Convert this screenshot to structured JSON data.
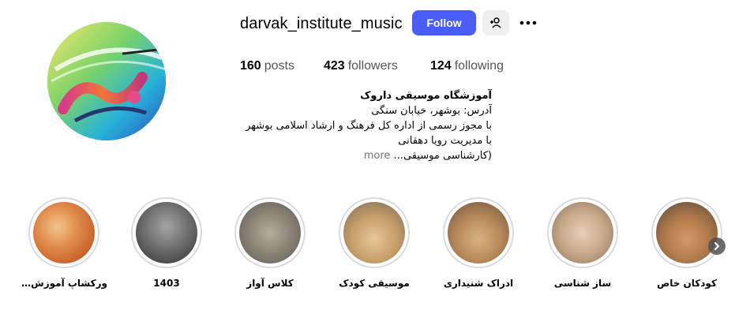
{
  "profile": {
    "username": "darvak_institute_music",
    "follow_label": "Follow",
    "avatar_icon": "darvak-logo",
    "stats": {
      "posts_count": "160",
      "posts_label": "posts",
      "followers_count": "423",
      "followers_label": "followers",
      "following_count": "124",
      "following_label": "following"
    },
    "bio": {
      "name": "آموزشگاه موسیقی داروک",
      "line1": "آدرس: بوشهر، خیابان سنگی",
      "line2": "با مجوز رسمی از اداره کل فرهنگ و ارشاد اسلامی بوشهر",
      "line3": "با مدیریت رویا دهقانی",
      "line4": "(کارشناسی موسیقی...",
      "more_label": "more"
    }
  },
  "highlights": [
    {
      "label": "ورکشاپ آموزش...",
      "thumb_color": "#e8a060"
    },
    {
      "label": "1403",
      "thumb_color": "#6b6b6b"
    },
    {
      "label": "کلاس آواز",
      "thumb_color": "#8a8174"
    },
    {
      "label": "موسیقی کودک",
      "thumb_color": "#c8a06a"
    },
    {
      "label": "ادراک شنیداری",
      "thumb_color": "#b88a5a"
    },
    {
      "label": "ساز شناسی",
      "thumb_color": "#c7a98a"
    },
    {
      "label": "کودکان خاص",
      "thumb_color": "#b07a4a"
    }
  ],
  "colors": {
    "follow_bg": "#4a5df9",
    "secondary_bg": "#efefef",
    "ring": "#dbdbdb"
  }
}
